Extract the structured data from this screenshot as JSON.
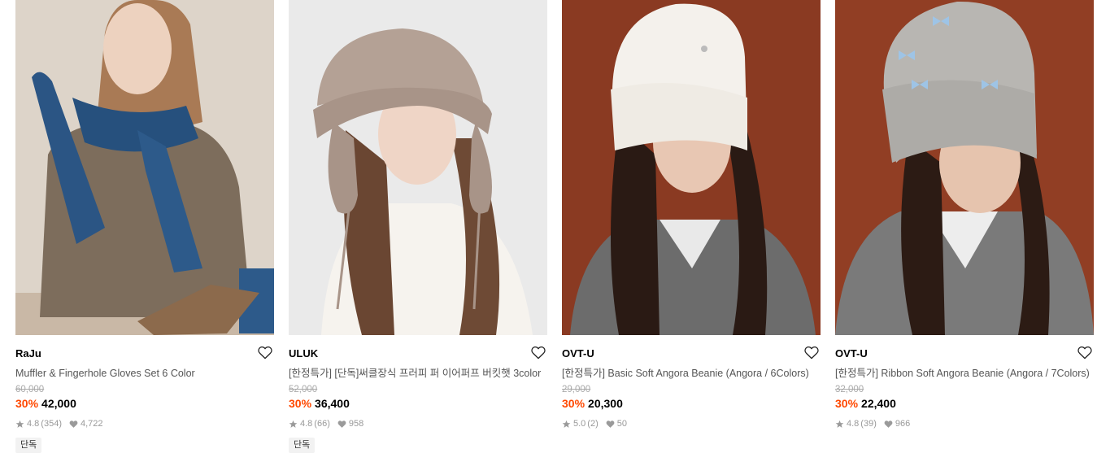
{
  "products": [
    {
      "brand": "RaJu",
      "name": "Muffler & Fingerhole Gloves Set 6 Color",
      "original_price": "60,000",
      "discount": "30%",
      "price": "42,000",
      "rating": "4.8",
      "reviews": "(354)",
      "likes": "4,722",
      "badge": "단독",
      "image_alt": "Model wearing blue knit muffler and fingerhole gloves"
    },
    {
      "brand": "ULUK",
      "name": "[한정특가] [단독]써클장식 프러피 퍼 이어퍼프 버킷햇 3color",
      "original_price": "52,000",
      "discount": "30%",
      "price": "36,400",
      "rating": "4.8",
      "reviews": "(66)",
      "likes": "958",
      "badge": "단독",
      "image_alt": "Model wearing beige fluffy fur bucket hat with ear puffs"
    },
    {
      "brand": "OVT-U",
      "name": "[한정특가] Basic Soft Angora Beanie (Angora / 6Colors)",
      "original_price": "29,000",
      "discount": "30%",
      "price": "20,300",
      "rating": "5.0",
      "reviews": "(2)",
      "likes": "50",
      "image_alt": "Model wearing white angora beanie"
    },
    {
      "brand": "OVT-U",
      "name": "[한정특가] Ribbon Soft Angora Beanie (Angora / 7Colors)",
      "original_price": "32,000",
      "discount": "30%",
      "price": "22,400",
      "rating": "4.8",
      "reviews": "(39)",
      "likes": "966",
      "image_alt": "Model wearing grey angora beanie with blue ribbons"
    }
  ],
  "colors": {
    "discount": "#ff4800",
    "meta": "#999999",
    "name": "#555555",
    "badge_bg": "#f2f2f2"
  },
  "icons": {
    "wishlist": "heart-outline-icon",
    "rating": "star-icon",
    "likes": "heart-filled-icon"
  }
}
